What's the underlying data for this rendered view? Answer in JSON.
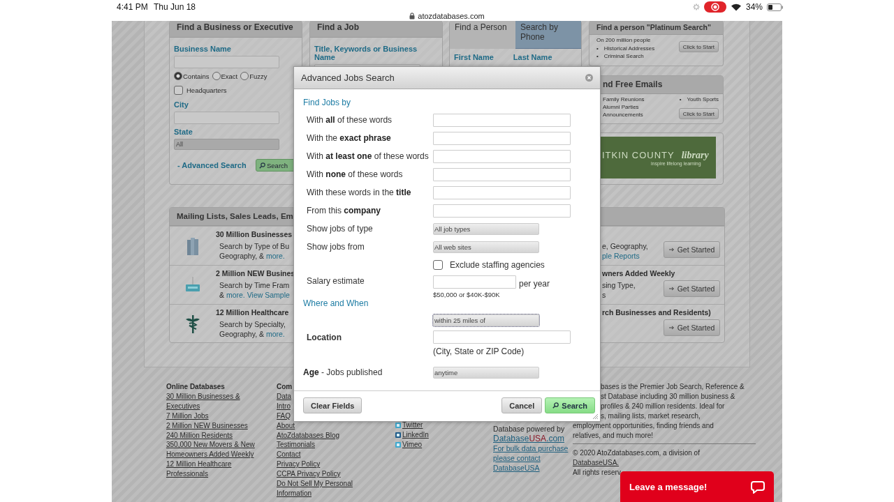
{
  "status_bar": {
    "time": "4:41 PM",
    "date": "Thu Jun 18",
    "url": "atozdatabases.com",
    "battery": "34%"
  },
  "business_panel": {
    "heading": "Find a Business or Executive",
    "name_label": "Business Name",
    "match_options": [
      {
        "label": "Contains",
        "selected": true
      },
      {
        "label": "Exact",
        "selected": false
      },
      {
        "label": "Fuzzy",
        "selected": false
      }
    ],
    "headquarters": {
      "label": "Headquarters",
      "checked": false
    },
    "city_label": "City",
    "state_label": "State",
    "state_value": "All",
    "advanced_link": "- Advanced Search",
    "search_button": "Search"
  },
  "job_panel": {
    "heading": "Find a Job",
    "keywords_label": "Title, Keywords or Business Name"
  },
  "person_panel": {
    "tabs": [
      {
        "label": "Find a Person",
        "selected": true
      },
      {
        "label": "Search by Phone",
        "selected": false
      }
    ],
    "fields": [
      "First Name",
      "Last Name"
    ]
  },
  "platinum_panel": {
    "heading": "Find a person \"Platinum Search\"",
    "intro": "On 200 million people",
    "bullet": "•",
    "items": [
      "Historical Addresses",
      "Criminal Search"
    ],
    "button": "Click to Start"
  },
  "emails_panel": {
    "heading": "nd Free Emails",
    "items_left": [
      "Family Reunions",
      "Alumni Parties",
      "Announcements"
    ],
    "items_right": [
      "Youth Sports"
    ],
    "bullet": "•",
    "button": "Click to Start"
  },
  "library_banner": {
    "name": "ITKIN COUNTY",
    "word": "library",
    "tagline": "inspire lifelong learning"
  },
  "lists_panel": {
    "heading": "Mailing Lists, Sales Leads, Em",
    "rows": [
      {
        "kind": "buildings",
        "title": "30 Million Businesses",
        "lines": [
          [
            {
              "text": "Search by Type of Bu",
              "link": false
            }
          ],
          [
            {
              "text": "Geography, & ",
              "link": false
            },
            {
              "text": "more.",
              "link": true
            }
          ]
        ],
        "right_lines": [
          [
            {
              "text": "e, Geography,",
              "link": false
            }
          ],
          [
            {
              "text": "ple Reports",
              "link": true
            }
          ]
        ],
        "button": "Get Started"
      },
      {
        "kind": "sign",
        "title": "2 Million NEW Busines",
        "lines": [
          [
            {
              "text": "Search by Time Fram",
              "link": false
            }
          ],
          [
            {
              "text": "& ",
              "link": false
            },
            {
              "text": "more.",
              "link": true
            },
            {
              "text": "View Sample",
              "link": true
            }
          ]
        ],
        "right_title": "wners Added Weekly",
        "right_lines": [
          [
            {
              "text": "sing Type,",
              "link": false
            }
          ],
          [
            {
              "text": "s",
              "link": false
            }
          ]
        ],
        "button": "Get Started"
      },
      {
        "kind": "caduceus",
        "title": "12 Million Healthcare",
        "lines": [
          [
            {
              "text": "Search by Specialty,",
              "link": false
            }
          ],
          [
            {
              "text": "Geography, & ",
              "link": false
            },
            {
              "text": "more.",
              "link": true
            }
          ]
        ],
        "right_title": "rch Businesses and Residents)",
        "button": "Get Started"
      }
    ]
  },
  "footer": {
    "databases": {
      "heading": "Online Databases",
      "links": [
        "30 Million Businesses & Executives",
        "7 Million Jobs",
        "2 Million NEW Businesses",
        "240 Million Residents",
        "350,000 New Movers & New Homeowners Added Weekly",
        "12 Million Healthcare Professionals"
      ]
    },
    "company": {
      "heading": "Com",
      "links": [
        "Data",
        "Intro",
        "FAQ",
        "About",
        "AtoZdatabases Blog",
        "Testimonials",
        "Contact",
        "Privacy Policy",
        "CCPA Privacy Policy",
        "Do Not Sell My Personal Information"
      ]
    },
    "social": [
      {
        "kind": "twitter",
        "label": "Twitter"
      },
      {
        "kind": "linkedin",
        "label": "LinkedIn"
      },
      {
        "kind": "vimeo",
        "label": "Vimeo"
      }
    ],
    "powered": {
      "caption": "Database powered by",
      "brand": [
        {
          "text": "Database",
          "accent": false
        },
        {
          "text": "USA",
          "accent": true
        },
        {
          "text": ".com",
          "accent": false
        }
      ],
      "bulk_link": "For bulk data purchase please contact DatabaseUSA"
    },
    "about": {
      "partly_hidden_lines": [
        "bases is the Premier Job Search, Reference &",
        "st Database including 30 million business &",
        "profiles & 240 million residents. Ideal for",
        "s, mailing lists, market research,"
      ],
      "lines": [
        "employment opportunities, finding friends and",
        "relatives, and much more!"
      ],
      "copyright": "© 2020 AtoZdatabases.com, a division of",
      "company_link": "DatabaseUSA.",
      "rights": "All rights reserv"
    }
  },
  "modal": {
    "title": "Advanced Jobs Search",
    "sections": [
      {
        "heading": "Find Jobs by",
        "rows": [
          {
            "kind": "text",
            "label": "With **all** of these words"
          },
          {
            "kind": "text",
            "label": "With the **exact phrase**"
          },
          {
            "kind": "text",
            "label": "With **at least one** of these words"
          },
          {
            "kind": "text",
            "label": "With **none** of these words"
          },
          {
            "kind": "text",
            "label": "With these words in the **title**"
          },
          {
            "kind": "text",
            "label": "From this **company**"
          },
          {
            "kind": "select",
            "label": "Show jobs of type",
            "value": "All job types"
          },
          {
            "kind": "select",
            "label": "Show jobs from",
            "value": "All web sites"
          },
          {
            "kind": "checkbox",
            "label": "Exclude staffing agencies",
            "checked": false
          },
          {
            "kind": "salary",
            "label": "Salary estimate",
            "unit": "per year",
            "hint": "$50,000 or $40K-$90K"
          }
        ]
      },
      {
        "heading": "Where and When",
        "rows": [
          {
            "kind": "location",
            "label": "Location",
            "value": "within 25 miles of",
            "focused": true,
            "hint": "(City, State or ZIP Code)"
          },
          {
            "kind": "age",
            "label": "**Age** - Jobs published",
            "value": "anytime"
          }
        ]
      }
    ],
    "buttons": [
      {
        "label": "Clear Fields",
        "kind": "plain"
      },
      {
        "label": "Cancel",
        "kind": "plain"
      },
      {
        "label": "Search",
        "kind": "primary"
      }
    ]
  },
  "chat": {
    "label": "Leave a message!"
  }
}
